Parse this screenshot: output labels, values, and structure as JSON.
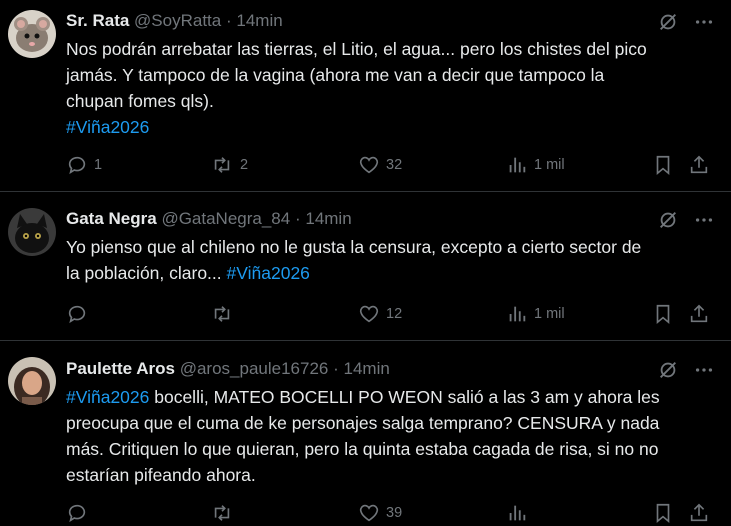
{
  "tweets": [
    {
      "name": "Sr. Rata",
      "handle": "@SoyRatta",
      "separator": "·",
      "time": "14min",
      "text_lines": [
        "Nos podrán arrebatar las tierras, el Litio, el agua... pero los chistes del pico",
        "jamás. Y tampoco de la vagina (ahora me van a decir que tampoco la",
        "chupan fomes qls)."
      ],
      "hashtag_line": "#Viña2026",
      "replies": "1",
      "reposts": "2",
      "likes": "32",
      "views": "1 mil"
    },
    {
      "name": "Gata Negra",
      "handle": "@GataNegra_84",
      "separator": "·",
      "time": "14min",
      "text_line_1": "Yo pienso que al chileno no le gusta la censura, excepto a cierto sector de",
      "text_line_2_prefix": "la población, claro...",
      "hashtag": "#Viña2026",
      "replies": "",
      "reposts": "",
      "likes": "12",
      "views": "1 mil"
    },
    {
      "name": "Paulette Aros",
      "handle": "@aros_paule16726",
      "separator": "·",
      "time": "14min",
      "hashtag": "#Viña2026",
      "text_line_1_suffix": " bocelli, MATEO BOCELLI PO WEON salió a las 3 am y ahora les",
      "text_lines": [
        "preocupa que el cuma de ke personajes salga temprano? CENSURA y nada",
        "más. Critiquen lo que quieran, pero la quinta estaba cagada de risa, si no no",
        "estarían pifeando ahora."
      ],
      "likes": "39"
    }
  ],
  "icons": [
    "grok-icon",
    "more-icon",
    "reply-icon",
    "repost-icon",
    "like-icon",
    "views-icon",
    "bookmark-icon",
    "share-icon"
  ],
  "colors": {
    "background": "#000000",
    "text": "#e7e9ea",
    "muted": "#71767b",
    "hashtag": "#1d9bf0",
    "divider": "#2f3336"
  }
}
